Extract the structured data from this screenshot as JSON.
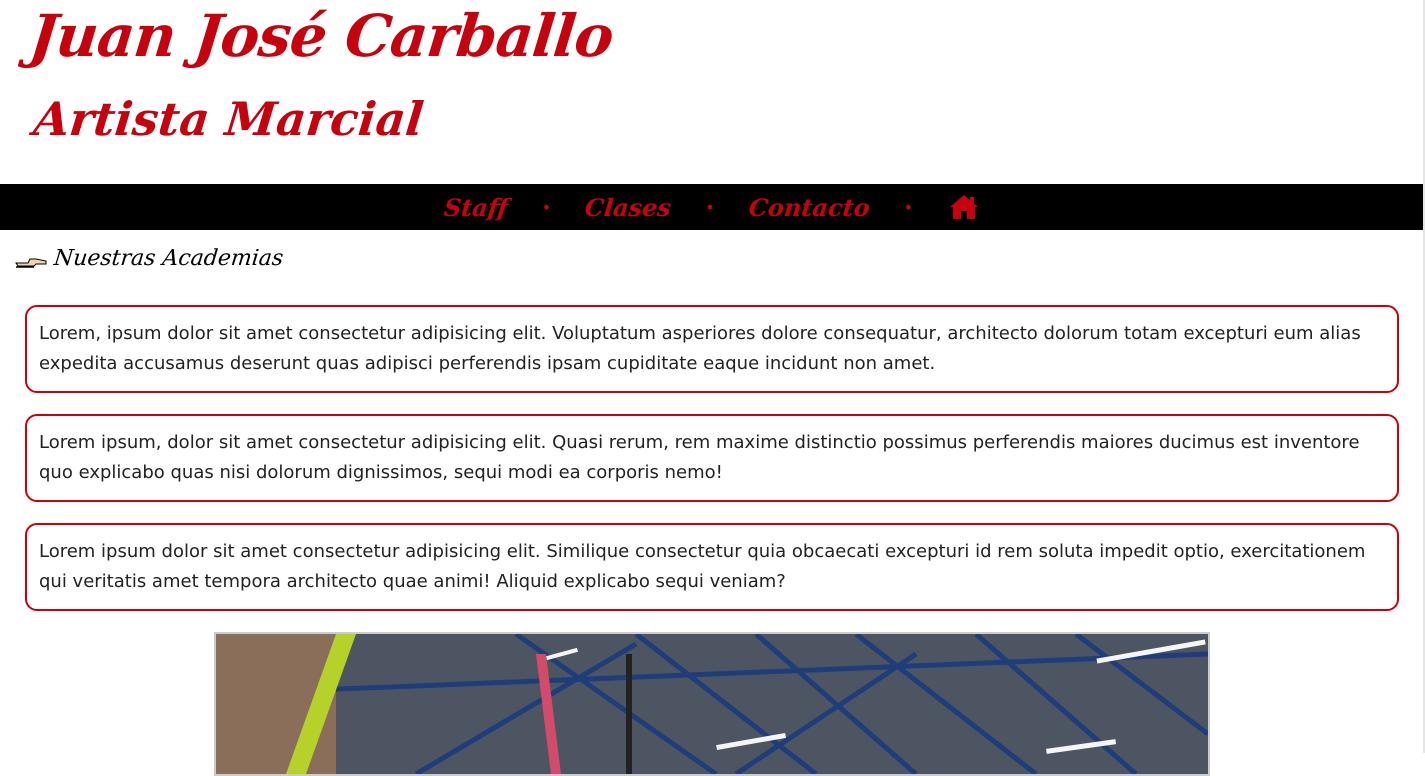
{
  "header": {
    "title": "Juan José Carballo",
    "subtitle": "Artista Marcial"
  },
  "nav": {
    "items": [
      "Staff",
      "Clases",
      "Contacto"
    ],
    "separator": "•",
    "home_icon": "home-icon"
  },
  "section": {
    "icon": "pointing-hand-icon",
    "title": "Nuestras Academias"
  },
  "cards": [
    "Lorem, ipsum dolor sit amet consectetur adipisicing elit. Voluptatum asperiores dolore consequatur, architecto dolorum totam excepturi eum alias expedita accusamus deserunt quas adipisci perferendis ipsam cupiditate eaque incidunt non amet.",
    "Lorem ipsum, dolor sit amet consectetur adipisicing elit. Quasi rerum, rem maxime distinctio possimus perferendis maiores ducimus est inventore quo explicabo quas nisi dolorum dignissimos, sequi modi ea corporis nemo!",
    "Lorem ipsum dolor sit amet consectetur adipisicing elit. Similique consectetur quia obcaecati excepturi id rem soluta impedit optio, exercitationem qui veritatis amet tempora architecto quae animi! Aliquid explicabo sequi veniam?"
  ],
  "colors": {
    "accent": "#c4030f",
    "nav_background": "#000000"
  }
}
